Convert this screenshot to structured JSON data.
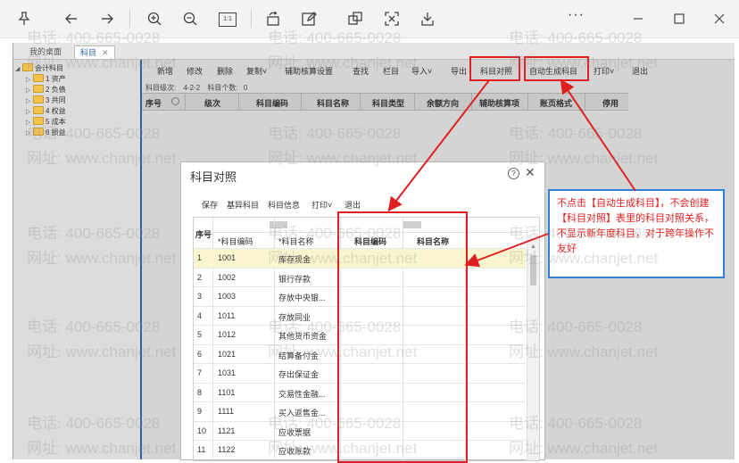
{
  "viewer_toolbar": {
    "icons": [
      "pin-icon",
      "back-icon",
      "forward-icon",
      "zoom-in-icon",
      "zoom-out-icon",
      "actual-size-icon",
      "rotate-icon",
      "edit-icon",
      "crop-icon",
      "fit-icon",
      "save-icon",
      "more-icon",
      "minimize-icon",
      "maximize-icon",
      "close-icon"
    ],
    "actual_size_label": "1:1",
    "more_label": "···"
  },
  "tabs": {
    "home": "我的桌面",
    "accounts": "科目",
    "close": "✕"
  },
  "tree": {
    "root": "会计科目",
    "items": [
      "1 资产",
      "2 负债",
      "3 共同",
      "4 权益",
      "5 成本",
      "6 损益"
    ]
  },
  "main_toolbar": {
    "buttons": [
      "新增",
      "修改",
      "删除",
      "复制",
      "辅助核算设置",
      "查找",
      "栏目",
      "导入",
      "导出",
      "科目对照",
      "自动生成科目",
      "打印",
      "退出"
    ]
  },
  "level_info": {
    "label": "科目级次:",
    "value": "4-2-2",
    "count_label": "科目个数:",
    "count": "0"
  },
  "grid_headers": [
    "序号",
    "级次",
    "科目编码",
    "科目名称",
    "科目类型",
    "余额方向",
    "辅助核算项",
    "账页格式",
    "停用"
  ],
  "dialog": {
    "title": "科目对照",
    "help": "?",
    "close": "✕",
    "toolbar": [
      "保存",
      "基异科目",
      "科目信息",
      "打印",
      "退出"
    ],
    "headers": {
      "seq": "序号",
      "code": "*科目编码",
      "name": "*科目名称",
      "target_code": "科目编码",
      "target_name": "科目名称"
    },
    "rows": [
      {
        "no": "1",
        "code": "1001",
        "name": "库存现金"
      },
      {
        "no": "2",
        "code": "1002",
        "name": "银行存款"
      },
      {
        "no": "3",
        "code": "1003",
        "name": "存放中央银..."
      },
      {
        "no": "4",
        "code": "1011",
        "name": "存放同业"
      },
      {
        "no": "5",
        "code": "1012",
        "name": "其他货币资金"
      },
      {
        "no": "6",
        "code": "1021",
        "name": "结算备付金"
      },
      {
        "no": "7",
        "code": "1031",
        "name": "存出保证金"
      },
      {
        "no": "8",
        "code": "1101",
        "name": "交易性金融..."
      },
      {
        "no": "9",
        "code": "1111",
        "name": "买入返售金..."
      },
      {
        "no": "10",
        "code": "1121",
        "name": "应收票据"
      },
      {
        "no": "11",
        "code": "1122",
        "name": "应收账款"
      }
    ]
  },
  "note": {
    "text": "不点击【自动生成科目】，不会创建【科目对照】表里的科目对照关系，不显示新年度科目，对于跨年操作不友好"
  },
  "watermark": {
    "phone": "电话: 400-665-0028",
    "site": "网址: www.chanjet.net"
  },
  "colors": {
    "annotation_red": "#e02020",
    "note_border": "#2f7fd6",
    "sidebar_accent": "#2f5fa7",
    "selected_row": "#fbf5cf"
  }
}
